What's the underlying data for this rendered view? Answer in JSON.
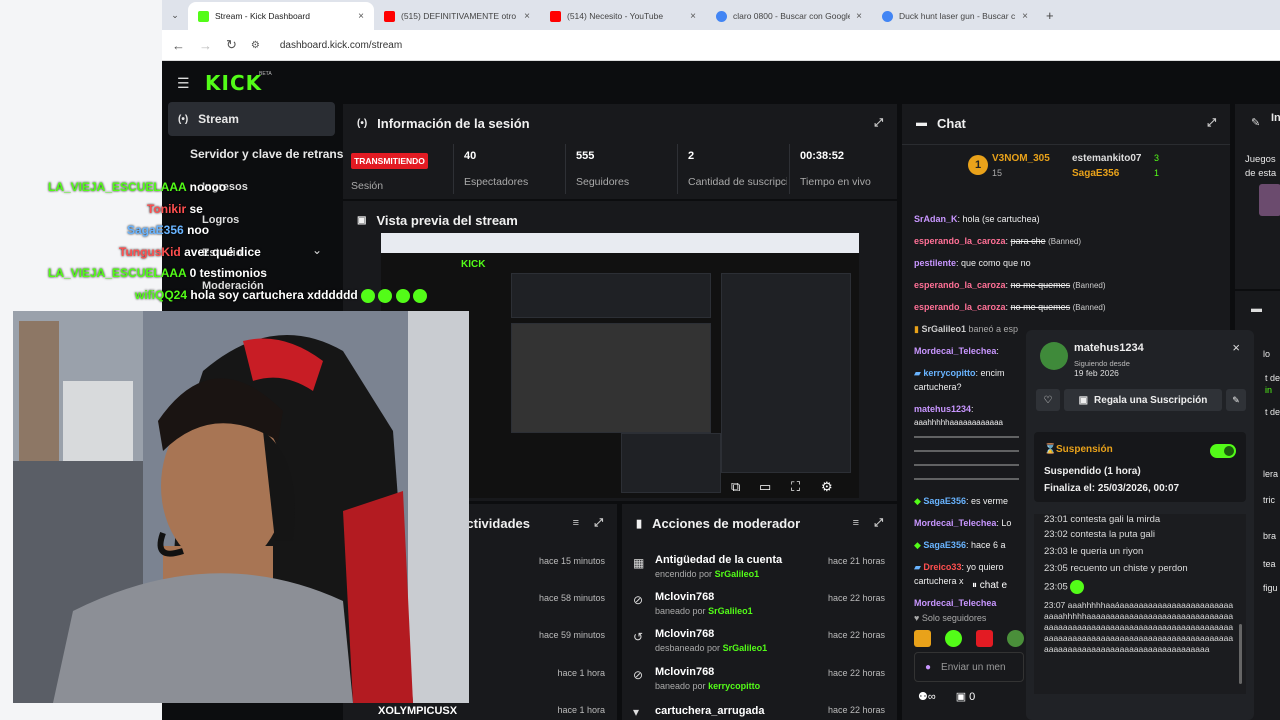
{
  "browser": {
    "tabs": [
      {
        "title": "Stream - Kick Dashboard",
        "active": true,
        "fav_color": "#53fc18"
      },
      {
        "title": "(515) DEFINITIVAMENTE otro H",
        "active": false,
        "fav_color": "#ff0000"
      },
      {
        "title": "(514) Necesito - YouTube",
        "active": false,
        "fav_color": "#ff0000"
      },
      {
        "title": "claro 0800 - Buscar con Google",
        "active": false,
        "fav_color": "#4285f4"
      },
      {
        "title": "Duck hunt laser gun - Buscar c",
        "active": false,
        "fav_color": "#4285f4"
      }
    ],
    "new_tab": "+",
    "url": "dashboard.kick.com/stream"
  },
  "sidebar": {
    "logo": "KICK",
    "beta": "BETA",
    "stream": "Stream",
    "server_key": "Servidor y clave de retransm",
    "items": [
      "Ingresos",
      "Logros",
      "Estudio",
      "Moderación"
    ]
  },
  "session": {
    "title": "Información de la sesión",
    "live_badge": "TRANSMITIENDO",
    "live_label": "Sesión",
    "stats": [
      {
        "value": "40",
        "label": "Espectadores"
      },
      {
        "value": "555",
        "label": "Seguidores"
      },
      {
        "value": "2",
        "label": "Cantidad de suscripciones"
      },
      {
        "value": "00:38:52",
        "label": "Tiempo en vivo"
      }
    ]
  },
  "preview": {
    "title": "Vista previa del stream"
  },
  "activity": {
    "title": "Actividades",
    "times": [
      "hace 15 minutos",
      "hace 58 minutos",
      "hace 59 minutos",
      "hace 1 hora",
      "hace 1 hora"
    ],
    "last_user": "XOLYMPICUSX"
  },
  "mod_actions": {
    "title": "Acciones de moderador",
    "rows": [
      {
        "title": "Antigüedad de la cuenta",
        "sub": "encendido por",
        "by": "SrGalileo1",
        "time": "hace 21 horas",
        "icon": "calendar-icon"
      },
      {
        "title": "Mclovin768",
        "sub": "baneado por",
        "by": "SrGalileo1",
        "time": "hace 22 horas",
        "icon": "ban-icon"
      },
      {
        "title": "Mclovin768",
        "sub": "desbaneado por",
        "by": "SrGalileo1",
        "time": "hace 22 horas",
        "icon": "undo-icon"
      },
      {
        "title": "Mclovin768",
        "sub": "baneado por",
        "by": "kerrycopitto",
        "time": "hace 22 horas",
        "icon": "ban-icon"
      },
      {
        "title": "cartuchera_arrugada",
        "sub": "",
        "by": "",
        "time": "hace 22 horas",
        "icon": "chevron-down-icon"
      }
    ]
  },
  "chat": {
    "title": "Chat",
    "top": [
      {
        "rank": "1",
        "name": "V3NOM_305",
        "count": "15"
      },
      {
        "name": "estemankito07",
        "count": "3"
      },
      {
        "name": "SagaE356",
        "count": "1"
      }
    ],
    "messages": [
      {
        "user": "SrAdan_K",
        "text": "hola (se cartuchea)",
        "color": "#c896ff"
      },
      {
        "user": "esperando_la_caroza",
        "text": "para che",
        "banned": "(Banned)",
        "color": "#ff7096"
      },
      {
        "user": "pestilente",
        "text": "que como que no",
        "color": "#c896ff"
      },
      {
        "user": "esperando_la_caroza",
        "text": "no me quemes",
        "banned": "(Banned)",
        "color": "#ff7096"
      },
      {
        "user": "esperando_la_caroza",
        "text": "no me quemes",
        "banned": "(Banned)",
        "color": "#ff7096"
      },
      {
        "user": "SrGalileo1",
        "text": "baneó a esp",
        "color": "#53fc18"
      },
      {
        "user": "Mordecai_Telechea",
        "text": "",
        "color": "#c896ff"
      },
      {
        "user": "kerrycopitto",
        "text": "encim",
        "color": "#69b4ff"
      },
      {
        "user": "",
        "text": "cartuchera?",
        "color": "#eee"
      },
      {
        "user": "matehus1234",
        "text": "",
        "color": "#c896ff"
      },
      {
        "user": "",
        "text": "aaahhhhhaaaaaaaaaaaa",
        "color": "#eee"
      },
      {
        "user": "SagaE356",
        "text": "es verme",
        "color": "#69b4ff"
      },
      {
        "user": "Mordecai_Telechea",
        "text": "Lo",
        "color": "#c896ff"
      },
      {
        "user": "SagaE356",
        "text": "hace 6 a",
        "color": "#69b4ff"
      },
      {
        "user": "Dreico33",
        "text": "yo quiero",
        "color": "#ff4f4f"
      },
      {
        "user": "",
        "text": "cartuchera x",
        "color": "#eee"
      },
      {
        "user": "Mordecai_Telechea",
        "text": "",
        "color": "#c896ff"
      }
    ],
    "paused": "chat e",
    "followers_only": "Solo seguidores",
    "send_placeholder": "Enviar un men",
    "viewers": "0"
  },
  "overlay_chat": [
    {
      "user": "LA_VIEJA_ESCUELAAA",
      "text": "noooo",
      "color": "#53fc18"
    },
    {
      "user": "Tonikir",
      "text": "se",
      "color": "#ff4f4f"
    },
    {
      "user": "SagaE356",
      "text": "noo",
      "color": "#69b4ff"
    },
    {
      "user": "TungusKid",
      "text": "aver qué dice",
      "color": "#ff4f4f"
    },
    {
      "user": "LA_VIEJA_ESCUELAAA",
      "text": "0 testimonios",
      "color": "#53fc18"
    },
    {
      "user": "wifiQQ24",
      "text": "hola soy cartuchera xdddddd",
      "color": "#53fc18"
    }
  ],
  "user_card": {
    "name": "matehus1234",
    "following_since_label": "Siguiendo desde",
    "following_since": "19 feb 2026",
    "gift_label": "Regala una Suscripción",
    "suspension_label": "Suspensión",
    "suspended": "Suspendido (1 hora)",
    "ends": "Finaliza el: 25/03/2026, 00:07",
    "log": [
      {
        "time": "23:01",
        "text": "contesta gali la mirda"
      },
      {
        "time": "23:02",
        "text": "contesta la puta gali"
      },
      {
        "time": "23:03",
        "text": "le queria un riyon"
      },
      {
        "time": "23:05",
        "text": "recuento un chiste y perdon"
      },
      {
        "time": "23:05",
        "text": ""
      },
      {
        "time": "23:07",
        "text": "aaahhhhhaaáaaaaaaaaaaaaaaaaaaaaaaaaaaaahhhhhaaaaaaaaaaaaaaaaaaaaaaaaaaaaaaaaaaaaaaaaaaaaaaaaaaaaaaaaaaaaaaaaaaaaaaaaaaaaaaaaaaaaaaaaaaaaaaaaaaaaaaaaaaaaaaaaaaaaaaaaaaaaaaaaaaaaaaaaaaaaaaaaaa"
      }
    ]
  },
  "right_panel": {
    "title": "In",
    "text1": "Juegos",
    "text2": "de esta",
    "letters": [
      "lo",
      "t de",
      "t de",
      "lera",
      "tric",
      "bra",
      "tea",
      "figu"
    ]
  }
}
